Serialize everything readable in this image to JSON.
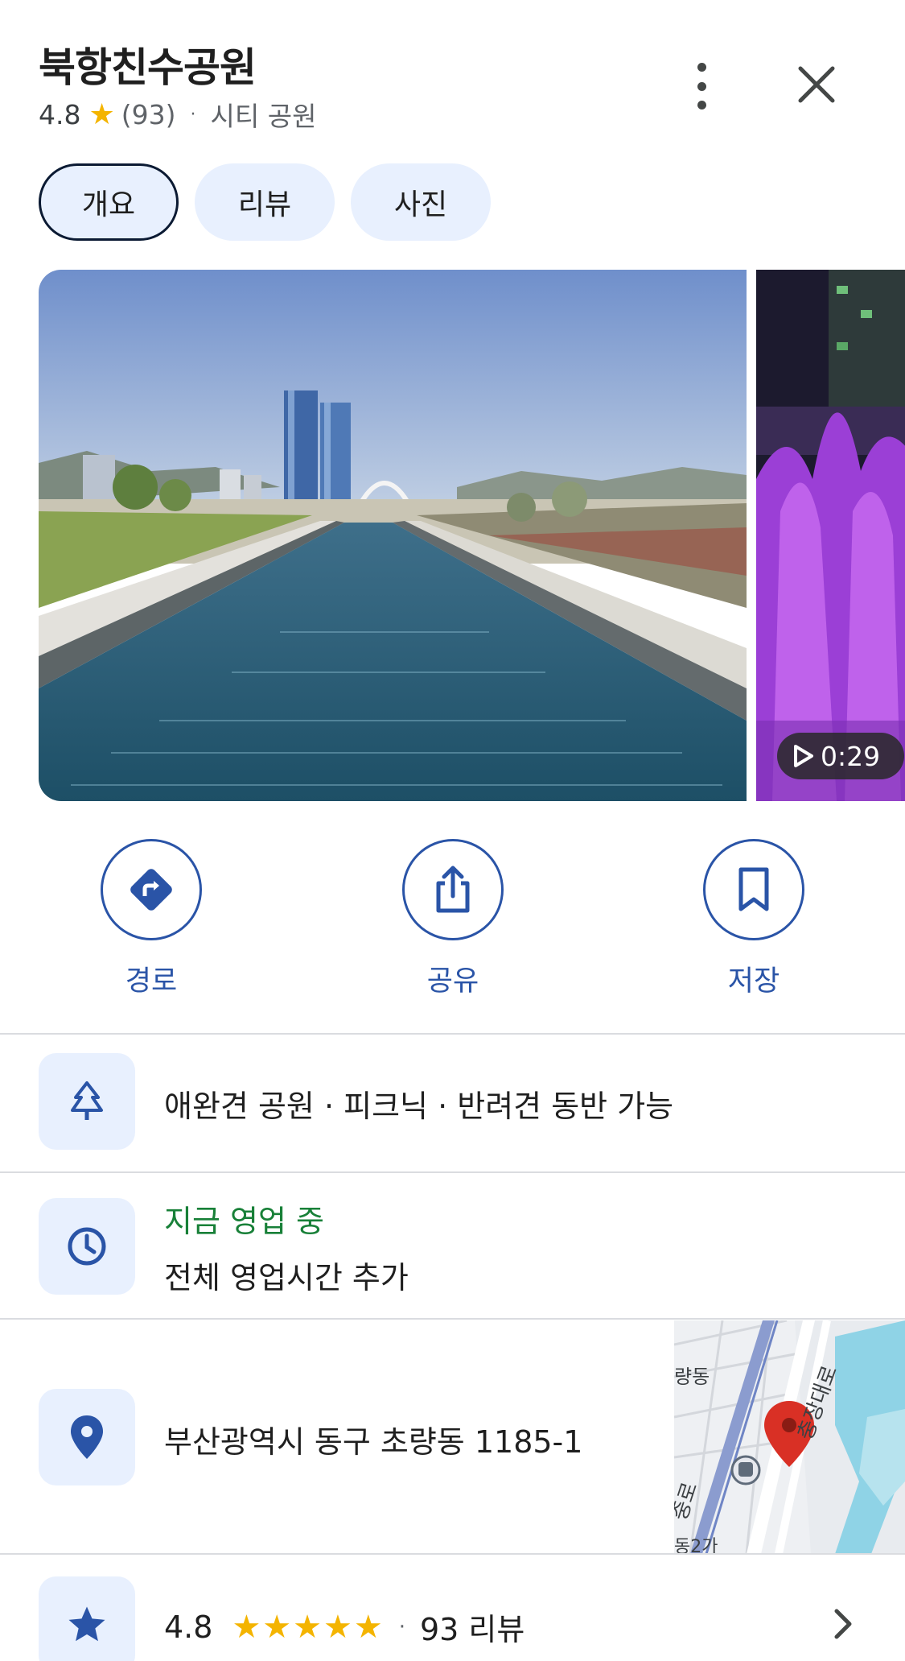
{
  "place": {
    "title": "북항친수공원",
    "rating": "4.8",
    "review_count": "(93)",
    "separator": "·",
    "category": "시티 공원"
  },
  "tabs": [
    {
      "label": "개요",
      "active": true
    },
    {
      "label": "리뷰",
      "active": false
    },
    {
      "label": "사진",
      "active": false
    }
  ],
  "media": {
    "video_duration": "0:29"
  },
  "actions": [
    {
      "label": "경로",
      "icon": "directions-icon"
    },
    {
      "label": "공유",
      "icon": "share-icon"
    },
    {
      "label": "저장",
      "icon": "bookmark-icon"
    }
  ],
  "info": {
    "amenities": "애완견 공원 · 피크닉 · 반려견 동반 가능",
    "hours_status": "지금 영업 중",
    "hours_action": "전체 영업시간 추가",
    "address": "부산광역시 동구 초량동 1185-1",
    "map_labels": [
      "량동",
      "충장대로",
      "중로",
      "동2가"
    ]
  },
  "reviews_summary": {
    "rating": "4.8",
    "stars_filled": 5,
    "separator": "·",
    "count_label": "93 리뷰"
  },
  "colors": {
    "accent_blue": "#2a54a7",
    "tile_bg": "#e8f0fe",
    "open_green": "#188038",
    "star_yellow": "#f4b400"
  }
}
